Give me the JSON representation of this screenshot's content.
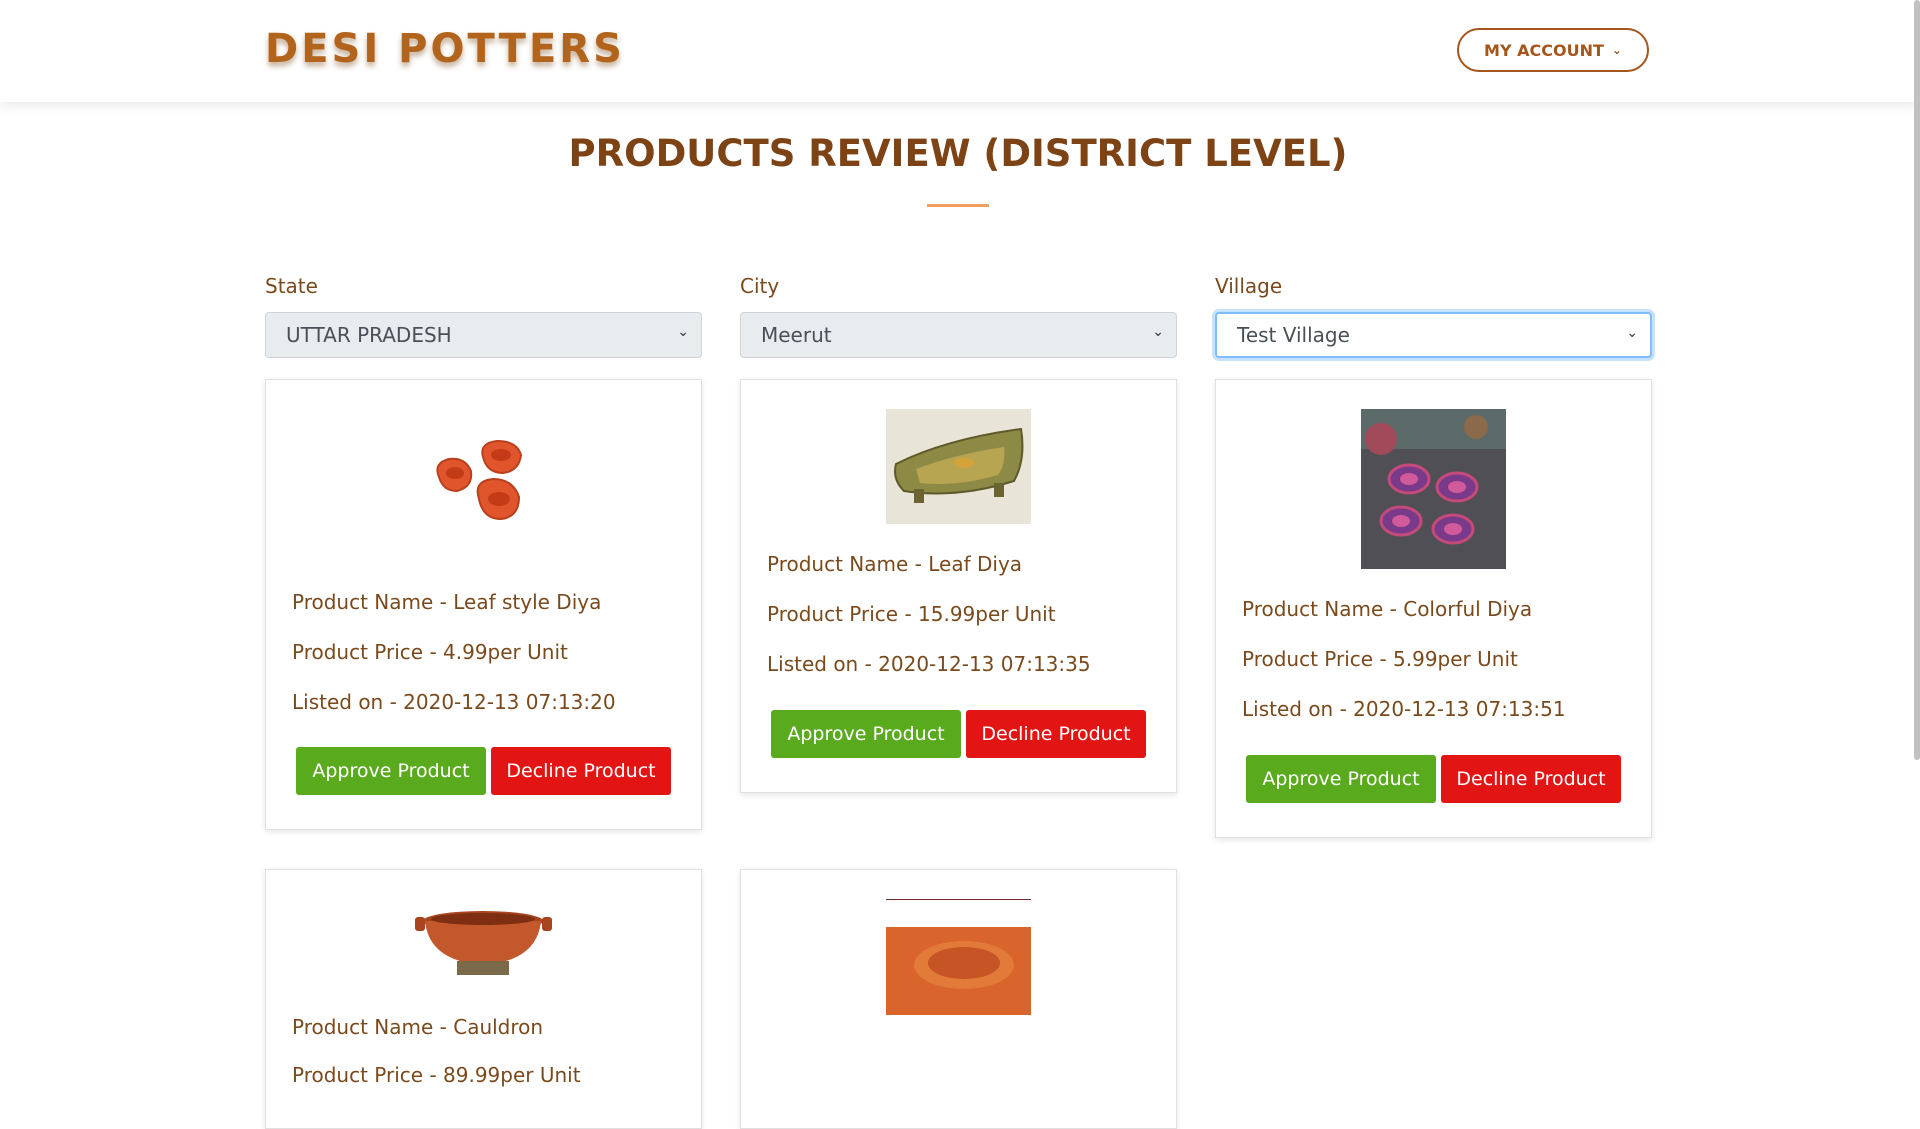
{
  "header": {
    "brand": "DESI POTTERS",
    "account_label": "MY ACCOUNT",
    "account_icon": "chevron-down-icon"
  },
  "page": {
    "title": "PRODUCTS REVIEW (DISTRICT LEVEL)"
  },
  "filters": {
    "state": {
      "label": "State",
      "value": "UTTAR PRADESH"
    },
    "city": {
      "label": "City",
      "value": "Meerut"
    },
    "village": {
      "label": "Village",
      "value": "Test Village"
    }
  },
  "products": [
    {
      "name": "Product Name - Leaf style Diya",
      "price": "Product Price - 4.99per Unit",
      "listed": "Listed on - 2020-12-13 07:13:20",
      "approve_label": "Approve Product",
      "decline_label": "Decline Product"
    },
    {
      "name": "Product Name - Leaf Diya",
      "price": "Product Price - 15.99per Unit",
      "listed": "Listed on - 2020-12-13 07:13:35",
      "approve_label": "Approve Product",
      "decline_label": "Decline Product"
    },
    {
      "name": "Product Name - Colorful Diya",
      "price": "Product Price - 5.99per Unit",
      "listed": "Listed on - 2020-12-13 07:13:51",
      "approve_label": "Approve Product",
      "decline_label": "Decline Product"
    },
    {
      "name": "Product Name - Cauldron",
      "price": "Product Price - 89.99per Unit"
    },
    {
      "name": "",
      "price": ""
    }
  ],
  "colors": {
    "brand": "#b3641c",
    "approve": "#5aaa1e",
    "decline": "#e21414",
    "accent_line": "#f0a05c"
  }
}
